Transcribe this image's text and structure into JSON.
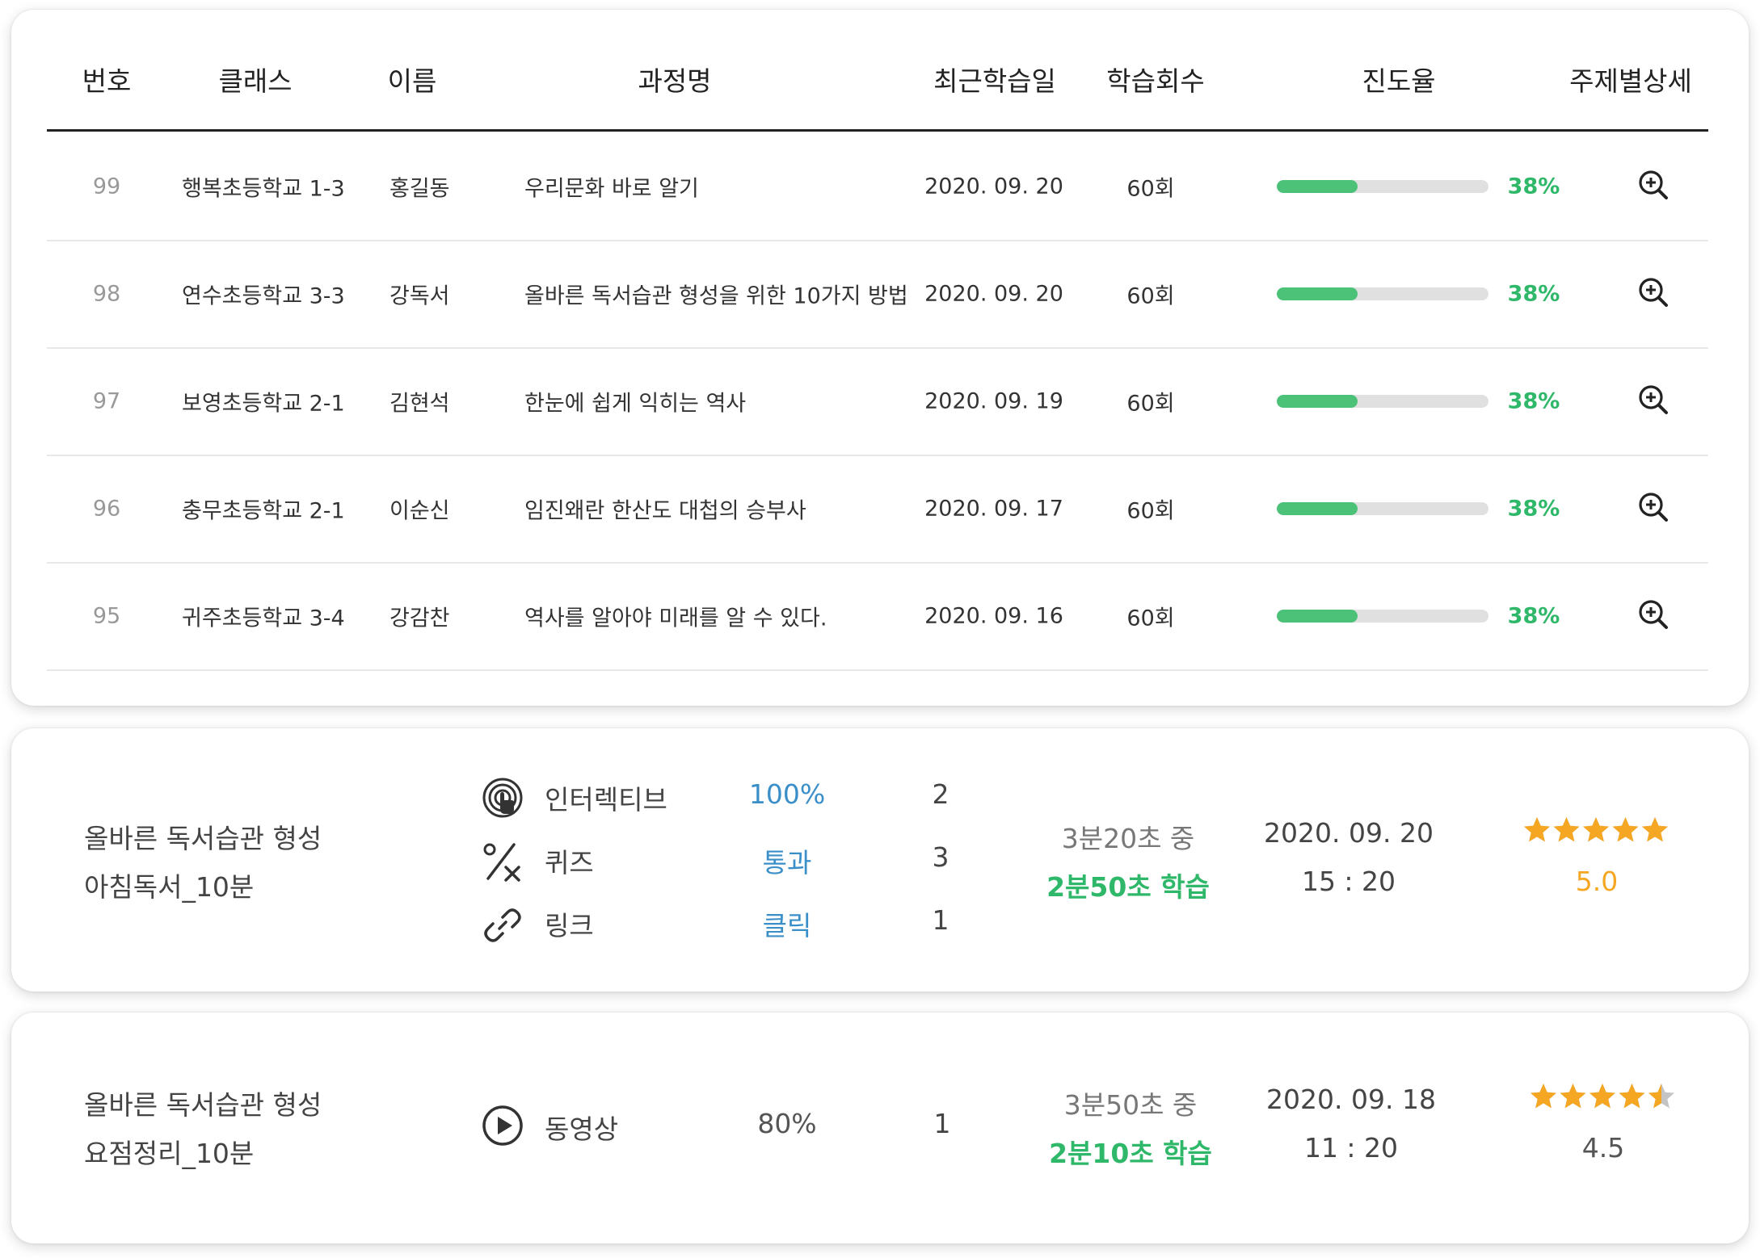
{
  "table": {
    "headers": [
      "번호",
      "클래스",
      "이름",
      "과정명",
      "최근학습일",
      "학습회수",
      "진도율",
      "주제별상세"
    ],
    "rows": [
      {
        "no": "99",
        "class": "행복초등학교 1-3",
        "name": "홍길동",
        "course": "우리문화 바로 알기",
        "date": "2020. 09. 20",
        "count": "60회",
        "progress": 0.38,
        "progress_label": "38%"
      },
      {
        "no": "98",
        "class": "연수초등학교 3-3",
        "name": "강독서",
        "course": "올바른 독서습관 형성을 위한 10가지 방법",
        "date": "2020. 09. 20",
        "count": "60회",
        "progress": 0.38,
        "progress_label": "38%"
      },
      {
        "no": "97",
        "class": "보영초등학교 2-1",
        "name": "김현석",
        "course": "한눈에 쉽게 익히는 역사",
        "date": "2020. 09. 19",
        "count": "60회",
        "progress": 0.38,
        "progress_label": "38%"
      },
      {
        "no": "96",
        "class": "충무초등학교 2-1",
        "name": "이순신",
        "course": "임진왜란 한산도 대첩의 승부사",
        "date": "2020. 09. 17",
        "count": "60회",
        "progress": 0.38,
        "progress_label": "38%"
      },
      {
        "no": "95",
        "class": "귀주초등학교 3-4",
        "name": "강감찬",
        "course": "역사를 알아야 미래를 알 수 있다.",
        "date": "2020. 09. 16",
        "count": "60회",
        "progress": 0.38,
        "progress_label": "38%"
      }
    ],
    "detail_icon": "zoom-in-icon",
    "colors": {
      "progress_fill": "#4cc279",
      "progress_track": "#e0e0e0",
      "progress_text": "#30b86a"
    }
  },
  "items": [
    {
      "title_line1": "올바른 독서습관 형성",
      "title_line2": "아침독서_10분",
      "activities": [
        {
          "icon": "touch-icon",
          "label": "인터렉티브",
          "value": "100%",
          "count": "2"
        },
        {
          "icon": "percent-icon",
          "label": "퀴즈",
          "value": "통과",
          "count": "3"
        },
        {
          "icon": "link-icon",
          "label": "링크",
          "value": "클릭",
          "count": "1"
        }
      ],
      "time_total": "3분20초 중",
      "time_learned": "2분50초 학습",
      "date": "2020. 09. 20",
      "time": "15 : 20",
      "rating": 5.0,
      "rating_label": "5.0",
      "rating_color": "#f5a623"
    },
    {
      "title_line1": "올바른 독서습관 형성",
      "title_line2": "요점정리_10분",
      "activities": [
        {
          "icon": "play-icon",
          "label": "동영상",
          "value": "80%",
          "count": "1"
        }
      ],
      "time_total": "3분50초 중",
      "time_learned": "2분10초 학습",
      "date": "2020. 09. 18",
      "time": "11 : 20",
      "rating": 4.5,
      "rating_label": "4.5",
      "rating_color": "#555555"
    }
  ]
}
